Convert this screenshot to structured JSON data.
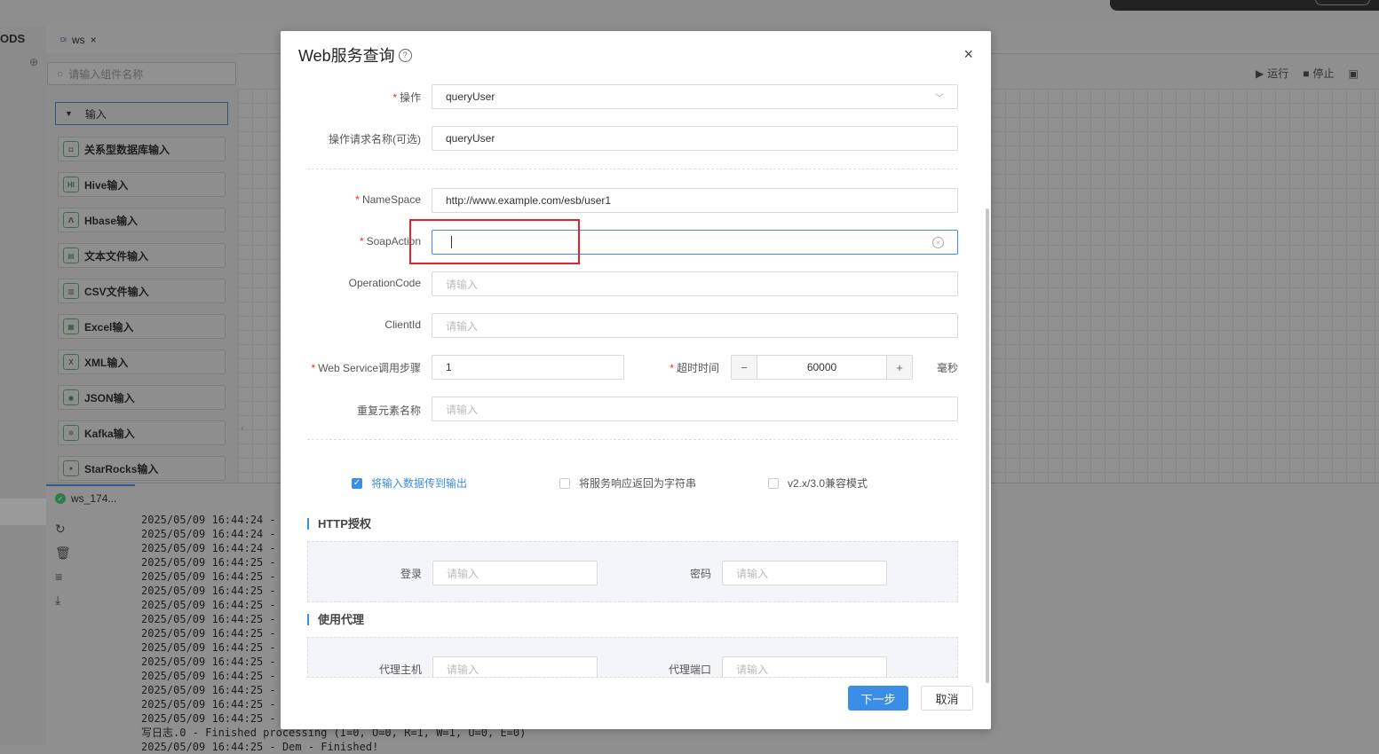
{
  "background": {
    "app_label": "ODS",
    "tab": {
      "badge": "DI",
      "label": "ws",
      "close": "×"
    },
    "toolbar": {
      "run": "运行",
      "stop": "停止"
    },
    "sidebar": {
      "search_placeholder": "请输入组件名称",
      "group_label": "输入",
      "items": [
        {
          "label": "关系型数据库输入",
          "icon": "database-icon"
        },
        {
          "label": "Hive输入",
          "icon": "hive-icon"
        },
        {
          "label": "Hbase输入",
          "icon": "hbase-icon"
        },
        {
          "label": "文本文件输入",
          "icon": "text-file-icon"
        },
        {
          "label": "CSV文件输入",
          "icon": "csv-file-icon"
        },
        {
          "label": "Excel输入",
          "icon": "excel-icon"
        },
        {
          "label": "XML输入",
          "icon": "xml-icon"
        },
        {
          "label": "JSON输入",
          "icon": "json-icon"
        },
        {
          "label": "Kafka输入",
          "icon": "kafka-icon"
        },
        {
          "label": "StarRocks输入",
          "icon": "starrocks-icon"
        }
      ]
    },
    "bottom_tab": "ws_174...",
    "log_lines": [
      "2025/05/09 16:44:24 -",
      "2025/05/09 16:44:24 -",
      "2025/05/09 16:44:24 -",
      "2025/05/09 16:44:25 -",
      "2025/05/09 16:44:25 -",
      "2025/05/09 16:44:25 -",
      "2025/05/09 16:44:25 -",
      "2025/05/09 16:44:25 -",
      "2025/05/09 16:44:25 -",
      "2025/05/09 16:44:25 -",
      "2025/05/09 16:44:25 -",
      "2025/05/09 16:44:25 -",
      "2025/05/09 16:44:25 -",
      "2025/05/09 16:44:25 -",
      "2025/05/09 16:44:25 -",
      "写日志.0 - Finished processing (I=0, O=0, R=1, W=1, U=0, E=0)",
      "2025/05/09 16:44:25 - Dem - Finished!"
    ]
  },
  "modal": {
    "title": "Web服务查询",
    "close": "×",
    "fields": {
      "operation": {
        "label": "操作",
        "value": "queryUser"
      },
      "request_name": {
        "label": "操作请求名称(可选)",
        "value": "queryUser"
      },
      "namespace": {
        "label": "NameSpace",
        "value": "http://www.example.com/esb/user1"
      },
      "soap_action": {
        "label": "SoapAction",
        "value": ""
      },
      "operation_code": {
        "label": "OperationCode",
        "placeholder": "请输入"
      },
      "client_id": {
        "label": "ClientId",
        "placeholder": "请输入"
      },
      "ws_step": {
        "label": "Web Service调用步骤",
        "value": "1"
      },
      "timeout": {
        "label": "超时时间",
        "value": "60000",
        "unit": "毫秒",
        "minus": "−",
        "plus": "+"
      },
      "repeat_element": {
        "label": "重复元素名称",
        "placeholder": "请输入"
      }
    },
    "checkboxes": [
      {
        "label": "将输入数据传到输出",
        "checked": true
      },
      {
        "label": "将服务响应返回为字符串",
        "checked": false
      },
      {
        "label": "v2.x/3.0兼容模式",
        "checked": false
      }
    ],
    "http_auth": {
      "title": "HTTP授权",
      "login": {
        "label": "登录",
        "placeholder": "请输入"
      },
      "password": {
        "label": "密码",
        "placeholder": "请输入"
      }
    },
    "proxy": {
      "title": "使用代理",
      "host": {
        "label": "代理主机",
        "placeholder": "请输入"
      },
      "port": {
        "label": "代理端口",
        "placeholder": "请输入"
      }
    },
    "buttons": {
      "next": "下一步",
      "cancel": "取消"
    }
  }
}
